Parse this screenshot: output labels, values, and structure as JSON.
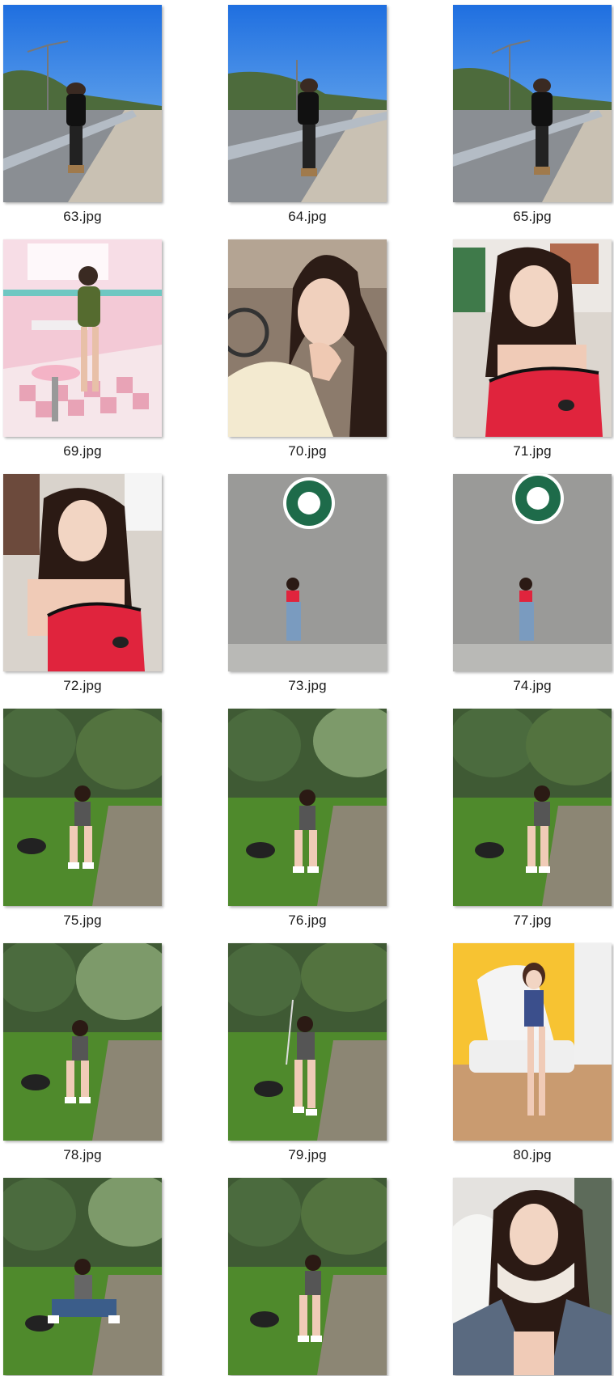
{
  "files": [
    {
      "name": "63.jpg",
      "icon": "photo-thumbnail-icon",
      "scene": "highway"
    },
    {
      "name": "64.jpg",
      "icon": "photo-thumbnail-icon",
      "scene": "highway"
    },
    {
      "name": "65.jpg",
      "icon": "photo-thumbnail-icon",
      "scene": "highway"
    },
    {
      "name": "69.jpg",
      "icon": "photo-thumbnail-icon",
      "scene": "diner"
    },
    {
      "name": "70.jpg",
      "icon": "photo-thumbnail-icon",
      "scene": "selfie-car"
    },
    {
      "name": "71.jpg",
      "icon": "photo-thumbnail-icon",
      "scene": "selfie-red"
    },
    {
      "name": "72.jpg",
      "icon": "photo-thumbnail-icon",
      "scene": "selfie-red"
    },
    {
      "name": "73.jpg",
      "icon": "photo-thumbnail-icon",
      "scene": "wall-logo"
    },
    {
      "name": "74.jpg",
      "icon": "photo-thumbnail-icon",
      "scene": "wall-logo"
    },
    {
      "name": "75.jpg",
      "icon": "photo-thumbnail-icon",
      "scene": "park"
    },
    {
      "name": "76.jpg",
      "icon": "photo-thumbnail-icon",
      "scene": "park"
    },
    {
      "name": "77.jpg",
      "icon": "photo-thumbnail-icon",
      "scene": "park"
    },
    {
      "name": "78.jpg",
      "icon": "photo-thumbnail-icon",
      "scene": "park"
    },
    {
      "name": "79.jpg",
      "icon": "photo-thumbnail-icon",
      "scene": "park"
    },
    {
      "name": "80.jpg",
      "icon": "photo-thumbnail-icon",
      "scene": "yellow-room"
    },
    {
      "name": "",
      "icon": "photo-thumbnail-icon",
      "scene": "park"
    },
    {
      "name": "",
      "icon": "photo-thumbnail-icon",
      "scene": "park"
    },
    {
      "name": "",
      "icon": "photo-thumbnail-icon",
      "scene": "selfie-headphones"
    }
  ],
  "colors": {
    "background": "#ffffff",
    "caption_text": "#1a1a1a"
  }
}
